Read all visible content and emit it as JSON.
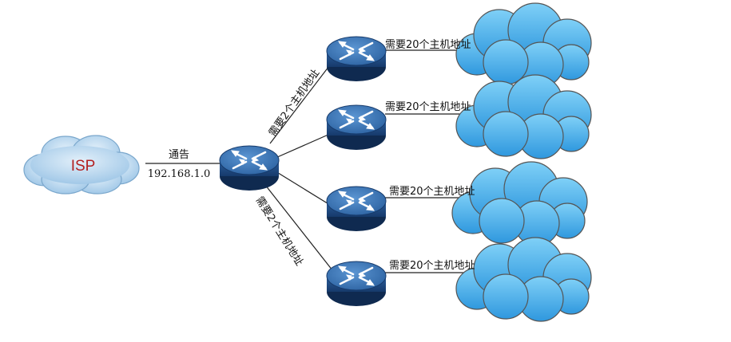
{
  "isp": {
    "label": "ISP"
  },
  "core_link": {
    "title": "通告",
    "network": "192.168.1.0"
  },
  "uplink_labels": {
    "top": "需要2个主机地址",
    "bottom": "需要2个主机地址"
  },
  "branches": [
    {
      "label": "需要20个主机地址"
    },
    {
      "label": "需要20个主机地址"
    },
    {
      "label": "需要20个主机地址"
    },
    {
      "label": "需要20个主机地址"
    }
  ],
  "colors": {
    "isp_cloud": "#b7d6ee",
    "branch_cloud": "#55b6ec",
    "router_body": "#1f4f8c",
    "router_top": "#3f7fc4",
    "isp_text": "#b32020"
  }
}
